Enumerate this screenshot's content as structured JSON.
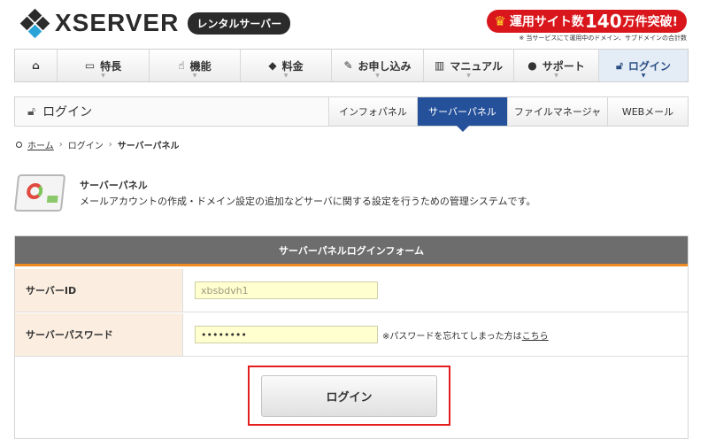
{
  "header": {
    "logo_text": "XSERVER",
    "logo_badge": "レンタルサーバー",
    "promo_prefix": "運用サイト数",
    "promo_number": "140",
    "promo_suffix": "万件突破!",
    "promo_note": "※ 当サービスにて運用中のドメイン、サブドメインの合計数"
  },
  "main_nav": [
    {
      "label": "",
      "icon": "home-icon"
    },
    {
      "label": "特長",
      "icon": "monitor-icon"
    },
    {
      "label": "機能",
      "icon": "pointer-icon"
    },
    {
      "label": "料金",
      "icon": "tag-icon"
    },
    {
      "label": "お申し込み",
      "icon": "pencil-icon"
    },
    {
      "label": "マニュアル",
      "icon": "book-icon"
    },
    {
      "label": "サポート",
      "icon": "user-icon"
    },
    {
      "label": "ログイン",
      "icon": "unlock-icon",
      "active": true
    }
  ],
  "sub_nav": {
    "title": "ログイン",
    "tabs": [
      "インフォパネル",
      "サーバーパネル",
      "ファイルマネージャ",
      "WEBメール"
    ],
    "active_tab": "サーバーパネル"
  },
  "breadcrumb": [
    "ホーム",
    "ログイン",
    "サーバーパネル"
  ],
  "intro": {
    "title": "サーバーパネル",
    "description": "メールアカウントの作成・ドメイン設定の追加などサーバに関する設定を行うための管理システムです。"
  },
  "form": {
    "header": "サーバーパネルログインフォーム",
    "server_id_label": "サーバーID",
    "server_id_value": "xbsbdvh1",
    "password_label": "サーバーパスワード",
    "password_value": "••••••••",
    "note_text": "※パスワードを忘れてしまった方は",
    "note_link": "こちら",
    "login_button": "ログイン"
  },
  "colors": {
    "brand_dark": "#2b2b2b",
    "active_tab": "#25519a",
    "form_header": "#6d6d6d",
    "form_accent": "#ef8a21",
    "label_bg": "#fbeee0",
    "input_bg": "#ffffcf",
    "highlight": "#e41d1d",
    "promo": "#d9161b"
  }
}
